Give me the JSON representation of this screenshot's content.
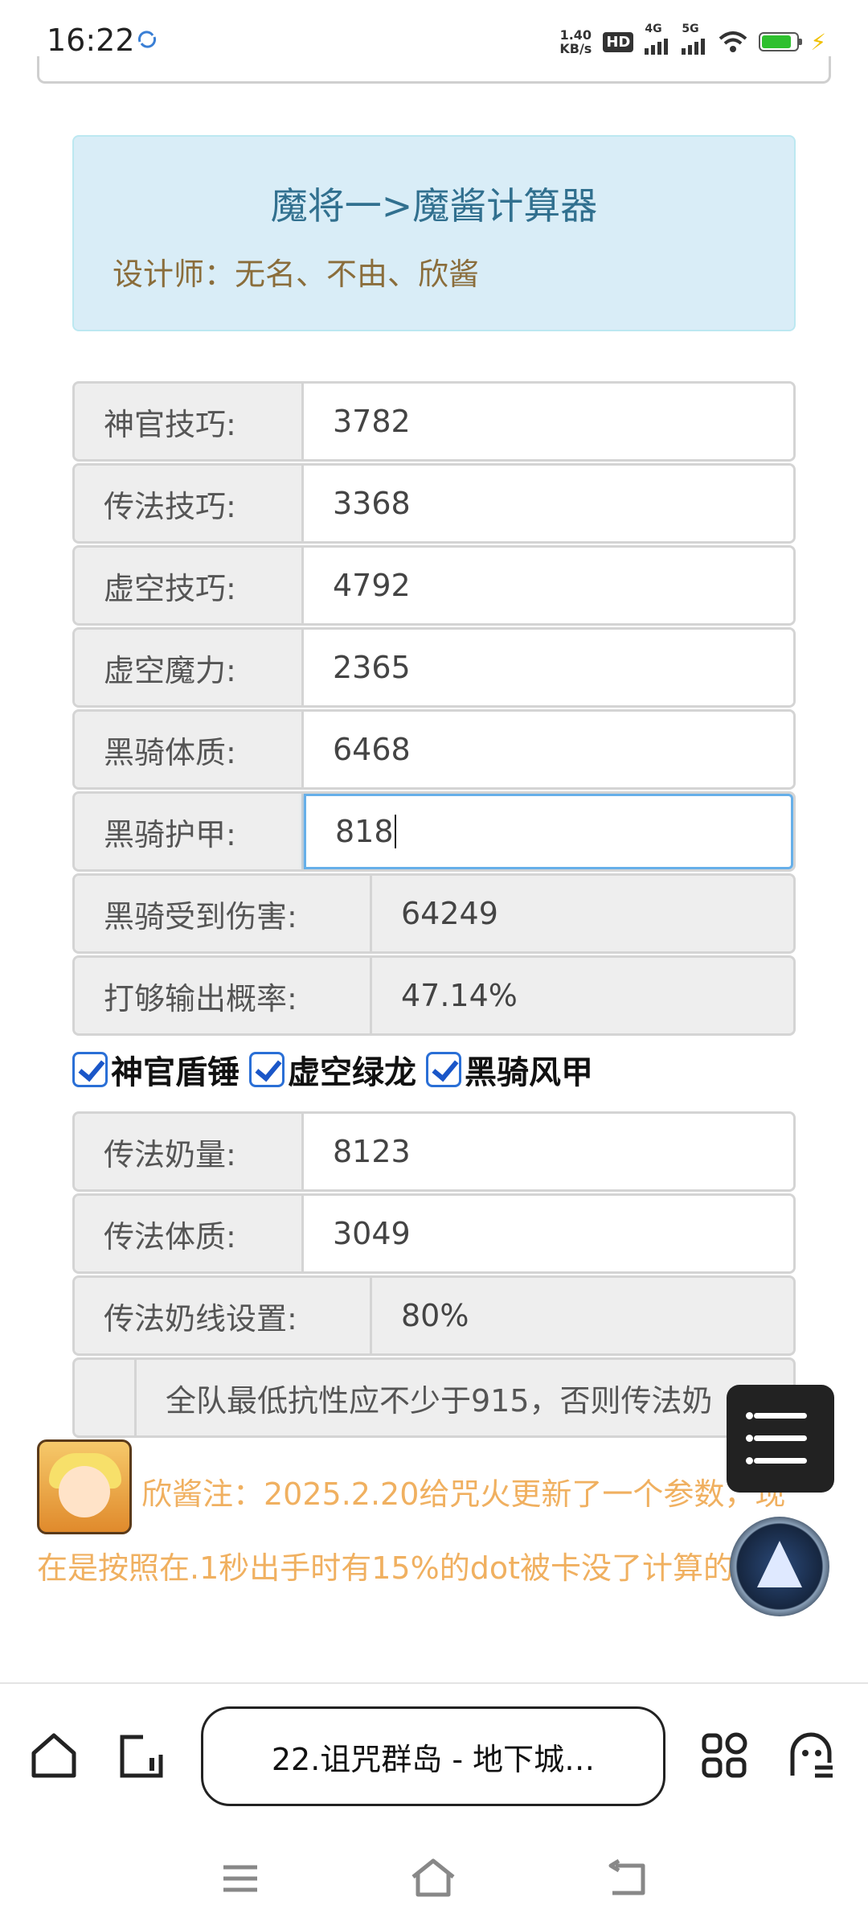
{
  "status_bar": {
    "time": "16:22",
    "net_speed_value": "1.40",
    "net_speed_unit": "KB/s",
    "hd_label": "HD",
    "sim1_label": "4G",
    "sim2_label": "5G",
    "battery_color": "#2ec02e"
  },
  "header": {
    "title": "魔将一>魔酱计算器",
    "designers": "设计师：无名、不由、欣酱"
  },
  "fields_top": [
    {
      "label": "神官技巧:",
      "value": "3782"
    },
    {
      "label": "传法技巧:",
      "value": "3368"
    },
    {
      "label": "虚空技巧:",
      "value": "4792"
    },
    {
      "label": "虚空魔力:",
      "value": "2365"
    },
    {
      "label": "黑骑体质:",
      "value": "6468"
    },
    {
      "label": "黑骑护甲:",
      "value": "818"
    }
  ],
  "results": [
    {
      "label": "黑骑受到伤害:",
      "value": "64249"
    },
    {
      "label": "打够输出概率:",
      "value": "47.14%"
    }
  ],
  "checkboxes": [
    {
      "label": "神官盾锤",
      "checked": true
    },
    {
      "label": "虚空绿龙",
      "checked": true
    },
    {
      "label": "黑骑风甲",
      "checked": true
    }
  ],
  "fields_bottom": [
    {
      "label": "传法奶量:",
      "value": "8123"
    },
    {
      "label": "传法体质:",
      "value": "3049"
    }
  ],
  "heal_line": {
    "label": "传法奶线设置:",
    "value": "80%"
  },
  "notice": "全队最低抗性应不少于915，否则传法奶",
  "note": "欣酱注：2025.2.20给咒火更新了一个参数，现在是按照在.1秒出手时有15%的dot被卡没了计算的。",
  "browser": {
    "url_title": "22.诅咒群岛 - 地下城…"
  },
  "icons": {
    "home": "home-icon",
    "tabs": "tabs-icon",
    "apps": "apps-grid-icon",
    "ghost": "ghost-icon",
    "float_menu": "list-menu-icon",
    "float_logo": "app-logo-icon"
  },
  "colors": {
    "header_bg": "#d9edf7",
    "header_title": "#31708f",
    "header_sub": "#8a6d3b",
    "note_text": "#f0b060",
    "focus": "#66afe9"
  }
}
